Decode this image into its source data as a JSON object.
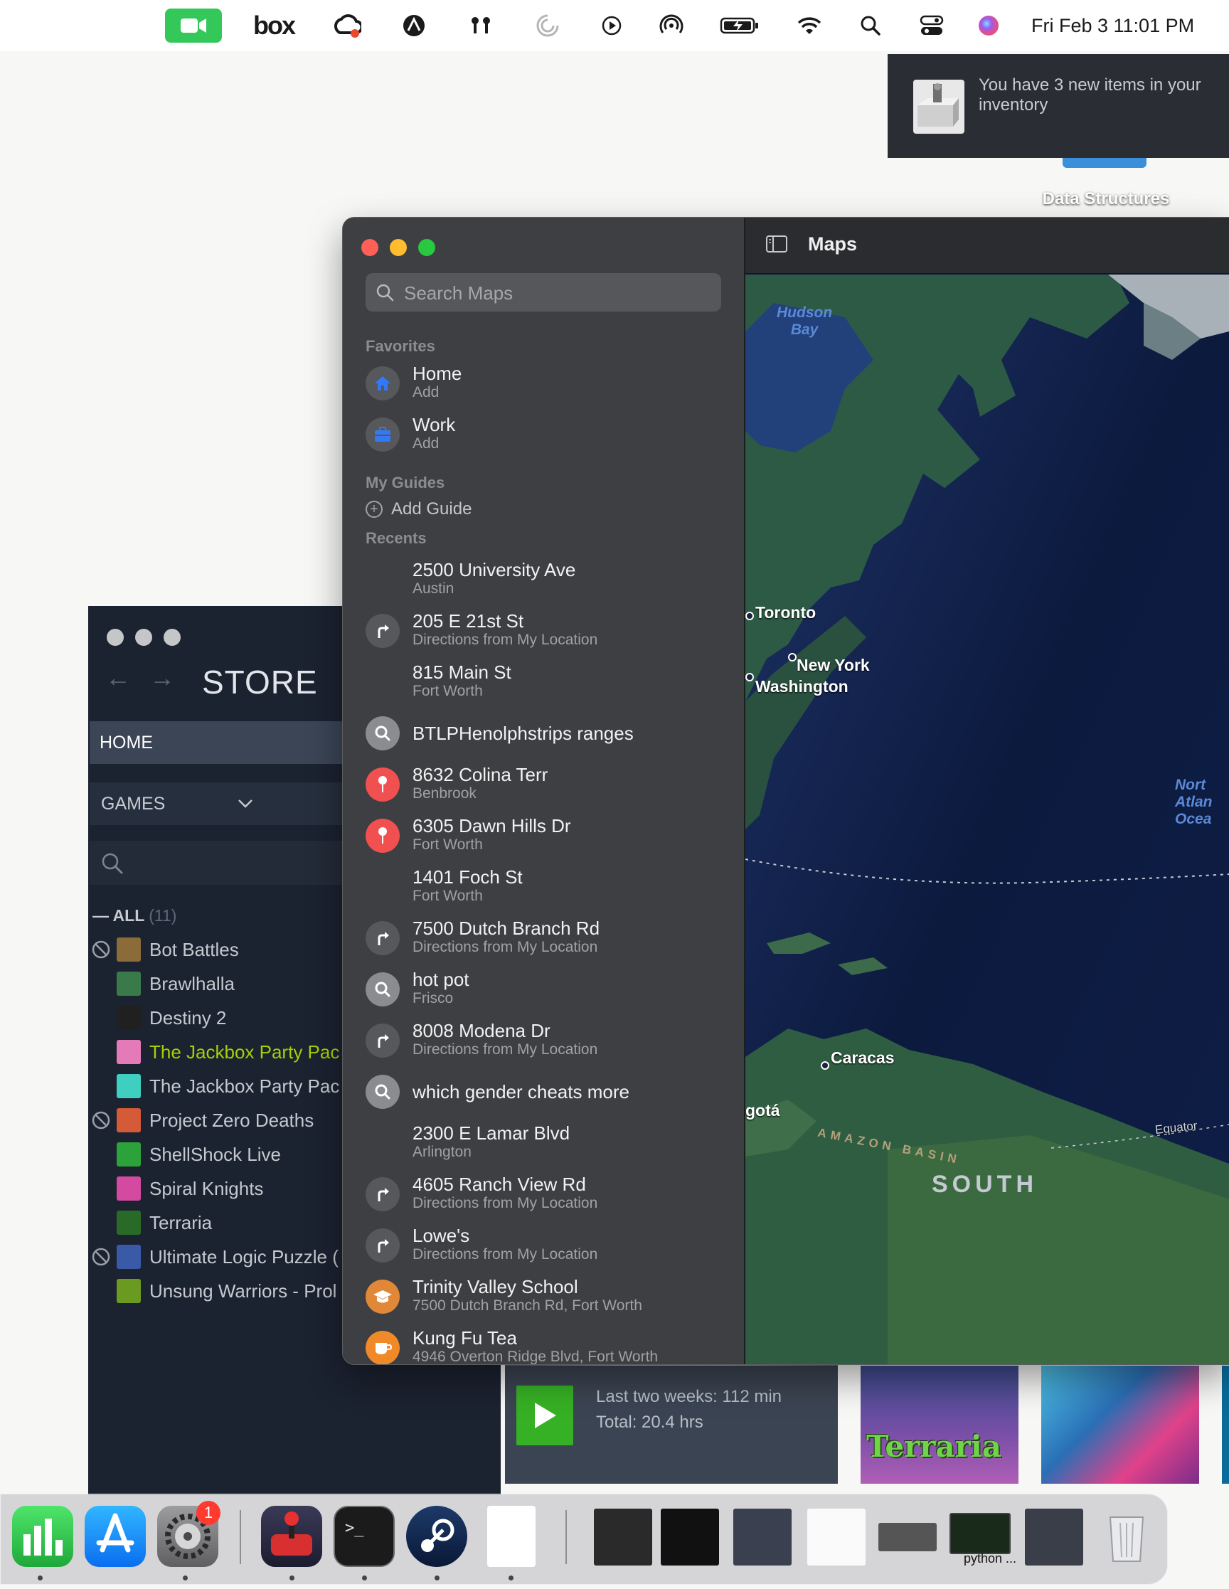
{
  "menubar": {
    "box_label": "box",
    "clock": "Fri Feb 3  11:01 PM",
    "icons": [
      "facetime-icon",
      "box-icon",
      "creative-cloud-icon",
      "monitor-icon",
      "airpods-icon",
      "loader-icon",
      "play-icon",
      "airdrop-icon",
      "battery-charging-icon",
      "wifi-icon",
      "spotlight-search-icon",
      "control-center-icon",
      "siri-icon"
    ]
  },
  "notification": {
    "text": "You have 3 new items in your inventory",
    "desktop_label": "Data Structures"
  },
  "steam": {
    "nav_back": "←",
    "nav_forward": "→",
    "store_label": "STORE",
    "home_label": "HOME",
    "games_label": "GAMES",
    "all_label": "ALL",
    "all_count": "(11)",
    "games": [
      {
        "name": "Bot Battles",
        "banned": true,
        "color": "#8b6b3a",
        "highlight": false
      },
      {
        "name": "Brawlhalla",
        "banned": false,
        "color": "#3a7a4a",
        "highlight": false
      },
      {
        "name": "Destiny 2",
        "banned": false,
        "color": "#202020",
        "highlight": false
      },
      {
        "name": "The Jackbox Party Pac",
        "banned": false,
        "color": "#e57ab8",
        "highlight": true
      },
      {
        "name": "The Jackbox Party Pac",
        "banned": false,
        "color": "#3ecfc0",
        "highlight": false
      },
      {
        "name": "Project Zero Deaths",
        "banned": true,
        "color": "#d45a38",
        "highlight": false
      },
      {
        "name": "ShellShock Live",
        "banned": false,
        "color": "#2ca23a",
        "highlight": false
      },
      {
        "name": "Spiral Knights",
        "banned": false,
        "color": "#d34aa0",
        "highlight": false
      },
      {
        "name": "Terraria",
        "banned": false,
        "color": "#2a6a28",
        "highlight": false
      },
      {
        "name": "Ultimate Logic Puzzle (",
        "banned": true,
        "color": "#3a5aa8",
        "highlight": false
      },
      {
        "name": "Unsung Warriors - Prol",
        "banned": false,
        "color": "#6a9a20",
        "highlight": false
      }
    ],
    "play_stats": {
      "two_weeks": "Last two weeks: 112 min",
      "total": "Total: 20.4 hrs"
    },
    "art_title": "Terraria"
  },
  "maps": {
    "title": "Maps",
    "search_placeholder": "Search Maps",
    "favorites_header": "Favorites",
    "favorites": [
      {
        "title": "Home",
        "subtitle": "Add",
        "icon": "home-icon"
      },
      {
        "title": "Work",
        "subtitle": "Add",
        "icon": "briefcase-icon"
      }
    ],
    "guides_header": "My Guides",
    "add_guide": "Add Guide",
    "recents_header": "Recents",
    "recents": [
      {
        "title": "2500 University Ave",
        "subtitle": "Austin",
        "icon": "none"
      },
      {
        "title": "205 E 21st St",
        "subtitle": "Directions from My Location",
        "icon": "directions-icon"
      },
      {
        "title": "815 Main St",
        "subtitle": "Fort Worth",
        "icon": "none"
      },
      {
        "title": "BTLPHenolphstrips ranges",
        "subtitle": "",
        "icon": "search-icon"
      },
      {
        "title": "8632 Colina Terr",
        "subtitle": "Benbrook",
        "icon": "pin-icon"
      },
      {
        "title": "6305 Dawn Hills Dr",
        "subtitle": "Fort Worth",
        "icon": "pin-icon"
      },
      {
        "title": "1401 Foch St",
        "subtitle": "Fort Worth",
        "icon": "none"
      },
      {
        "title": "7500 Dutch Branch Rd",
        "subtitle": "Directions from My Location",
        "icon": "directions-icon"
      },
      {
        "title": "hot pot",
        "subtitle": "Frisco",
        "icon": "search-icon"
      },
      {
        "title": "8008 Modena Dr",
        "subtitle": "Directions from My Location",
        "icon": "directions-icon"
      },
      {
        "title": "which gender cheats more",
        "subtitle": "",
        "icon": "search-icon"
      },
      {
        "title": "2300 E Lamar Blvd",
        "subtitle": "Arlington",
        "icon": "none"
      },
      {
        "title": "4605 Ranch View Rd",
        "subtitle": "Directions from My Location",
        "icon": "directions-icon"
      },
      {
        "title": "Lowe's",
        "subtitle": "Directions from My Location",
        "icon": "directions-icon"
      },
      {
        "title": "Trinity Valley School",
        "subtitle": "7500 Dutch Branch Rd, Fort Worth",
        "icon": "school-icon"
      },
      {
        "title": "Kung Fu Tea",
        "subtitle": "4946 Overton Ridge Blvd, Fort Worth",
        "icon": "cafe-icon"
      }
    ],
    "map_labels": {
      "hudson_bay": "Hudson\nBay",
      "toronto": "Toronto",
      "new_york": "New York",
      "washington": "Washington",
      "north_atlantic": "Nort\nAtlan\nOcea",
      "caracas": "Caracas",
      "bogota": "gotá",
      "equator": "Equator",
      "amazon_basin": "AMAZON BASIN",
      "south": "SOUTH"
    }
  },
  "dock": {
    "apps": [
      "numbers-icon",
      "app-store-icon",
      "system-settings-icon",
      "joystick-app-icon",
      "terminal-icon",
      "steam-icon",
      "document-icon"
    ],
    "settings_badge": "1",
    "python_label": "python ..."
  }
}
